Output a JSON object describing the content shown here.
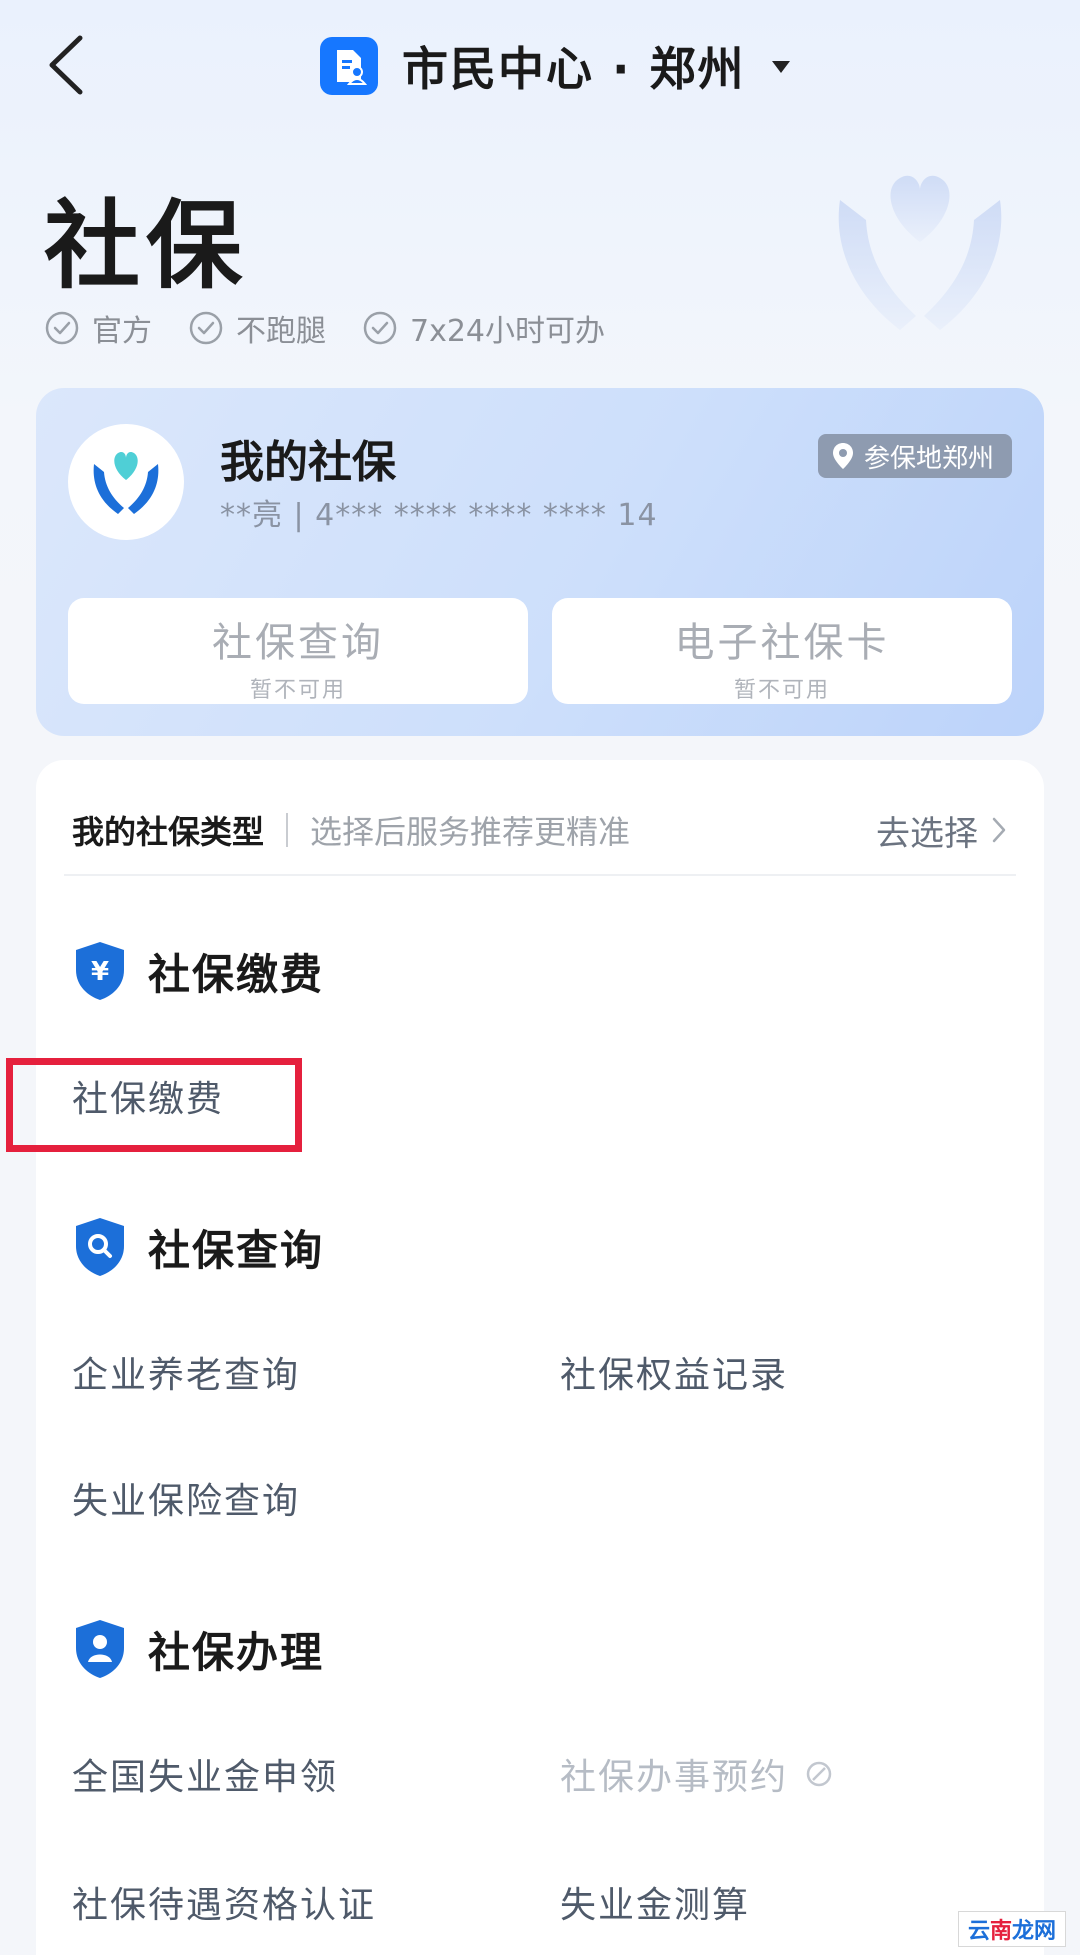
{
  "header": {
    "back_icon": "chevron-left-icon",
    "app_icon": "citizen-center-icon",
    "title": "市民中心 · 郑州",
    "dropdown_icon": "caret-down-icon"
  },
  "hero": {
    "title": "社保",
    "art_icon": "heart-hands-icon",
    "tags": [
      {
        "icon": "check-circle-icon",
        "label": "官方"
      },
      {
        "icon": "check-circle-icon",
        "label": "不跑腿"
      },
      {
        "icon": "check-circle-icon",
        "label": "7x24小时可办"
      }
    ]
  },
  "my_card": {
    "title": "我的社保",
    "subtitle": "**亮 | 4*** **** **** **** 14",
    "location_badge": "参保地郑州",
    "buttons": [
      {
        "label": "社保查询",
        "status": "暂不可用"
      },
      {
        "label": "电子社保卡",
        "status": "暂不可用"
      }
    ]
  },
  "type_selector": {
    "label": "我的社保类型",
    "hint": "选择后服务推荐更精准",
    "action": "去选择"
  },
  "sections": [
    {
      "icon": "yuan-shield-icon",
      "title": "社保缴费",
      "items": [
        {
          "label": "社保缴费",
          "enabled": true
        }
      ]
    },
    {
      "icon": "search-shield-icon",
      "title": "社保查询",
      "items": [
        {
          "label": "企业养老查询",
          "enabled": true
        },
        {
          "label": "社保权益记录",
          "enabled": true
        },
        {
          "label": "失业保险查询",
          "enabled": true
        }
      ]
    },
    {
      "icon": "user-shield-icon",
      "title": "社保办理",
      "items": [
        {
          "label": "全国失业金申领",
          "enabled": true
        },
        {
          "label": "社保办事预约",
          "enabled": false
        },
        {
          "label": "社保待遇资格认证",
          "enabled": true
        },
        {
          "label": "失业金测算",
          "enabled": true
        }
      ]
    }
  ],
  "watermark": {
    "part_a": "云",
    "part_b": "南",
    "part_c": "龙网"
  },
  "colors": {
    "accent": "#1677ff",
    "highlight": "#e5203d",
    "card_gradient_end": "#bcd3fa",
    "disabled_text": "#b6bcc5"
  }
}
